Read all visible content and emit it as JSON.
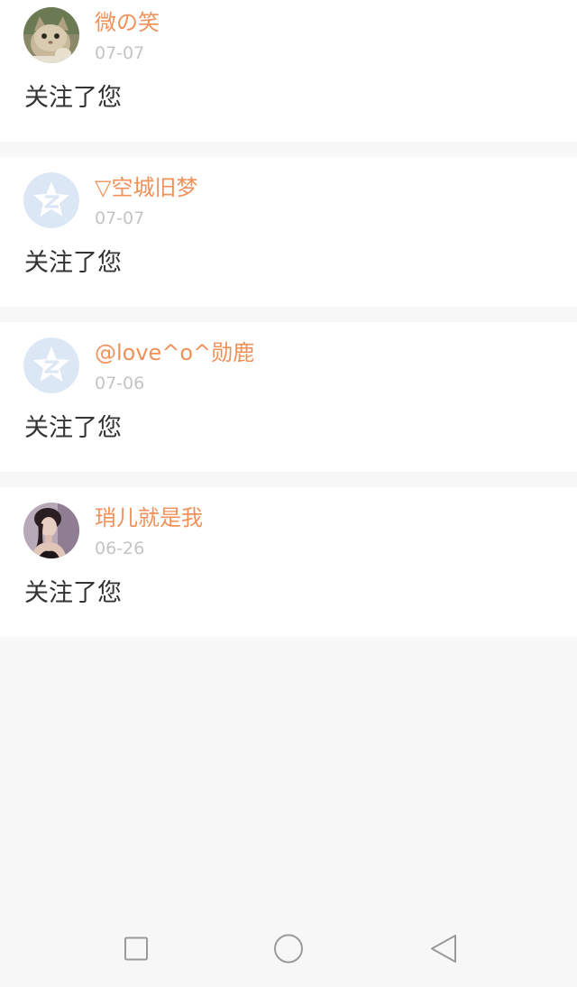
{
  "notifications": [
    {
      "name": "微の笑",
      "date": "07-07",
      "message": "关注了您",
      "avatar": "kitten-photo-avatar"
    },
    {
      "name": "▽空城旧梦",
      "date": "07-07",
      "message": "关注了您",
      "avatar": "qzone-star-avatar"
    },
    {
      "name": "@love^o^勋鹿",
      "date": "07-06",
      "message": "关注了您",
      "avatar": "qzone-star-avatar"
    },
    {
      "name": "琑儿就是我",
      "date": "06-26",
      "message": "关注了您",
      "avatar": "woman-photo-avatar"
    }
  ],
  "navbar": {
    "recent_icon": "square-icon",
    "home_icon": "circle-icon",
    "back_icon": "triangle-back-icon"
  },
  "colors": {
    "name": "#f0915a",
    "date": "#c4c4c4",
    "message": "#333333",
    "background": "#f8f7f7",
    "card": "#ffffff"
  }
}
